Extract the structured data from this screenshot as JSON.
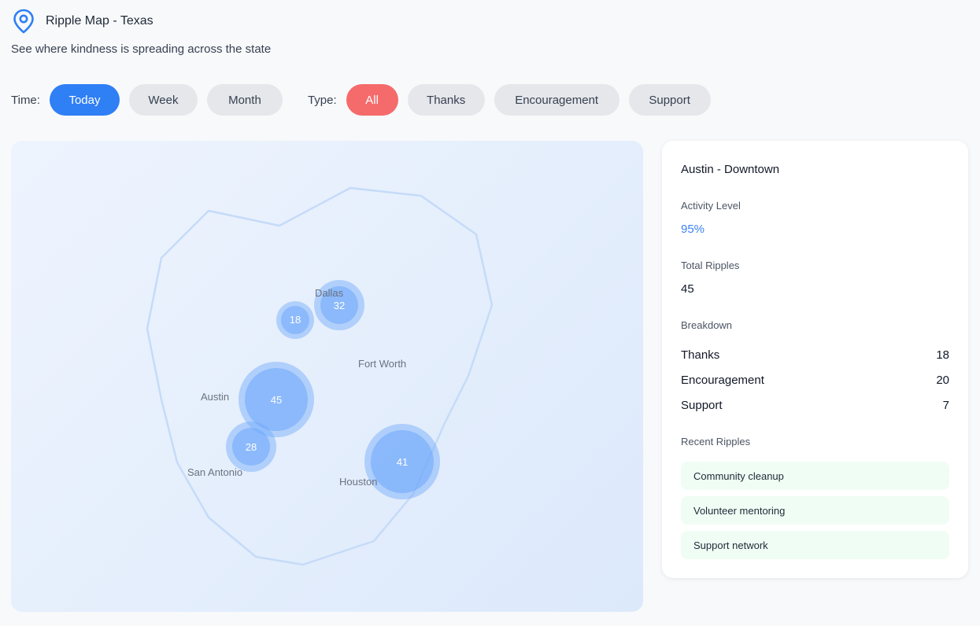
{
  "app": {
    "title": "Ripple Map - Texas",
    "subtitle": "See where kindness is spreading across the state"
  },
  "filters": {
    "time_label": "Time:",
    "time_options": [
      "Today",
      "Week",
      "Month"
    ],
    "time_selected": "Today",
    "type_label": "Type:",
    "type_options": [
      "All",
      "Thanks",
      "Encouragement",
      "Support"
    ],
    "type_selected": "All"
  },
  "map": {
    "city_labels": [
      "Dallas",
      "Fort Worth",
      "Austin",
      "San Antonio",
      "Houston"
    ],
    "bubbles": [
      {
        "count": "18"
      },
      {
        "count": "32"
      },
      {
        "count": "45"
      },
      {
        "count": "28"
      },
      {
        "count": "41"
      }
    ]
  },
  "details": {
    "title": "Austin - Downtown",
    "activity_label": "Activity Level",
    "activity_value": "95%",
    "total_label": "Total Ripples",
    "total_value": "45",
    "breakdown_label": "Breakdown",
    "breakdown": [
      {
        "name": "Thanks",
        "value": "18"
      },
      {
        "name": "Encouragement",
        "value": "20"
      },
      {
        "name": "Support",
        "value": "7"
      }
    ],
    "recent_label": "Recent Ripples",
    "recent": [
      "Community cleanup",
      "Volunteer mentoring",
      "Support network"
    ]
  },
  "colors": {
    "accent_blue": "#2f7ff5",
    "accent_red": "#f56b6b",
    "bubble_blue": "#6ea8fb",
    "recent_bg": "#f0fdf4"
  },
  "icons": {
    "header": "map-pin-icon"
  }
}
